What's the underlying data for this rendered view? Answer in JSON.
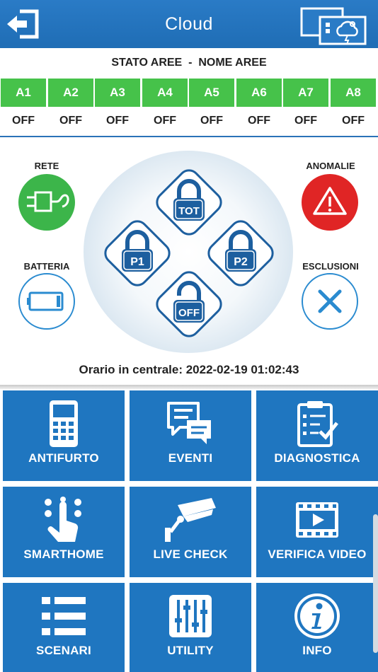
{
  "header": {
    "title": "Cloud"
  },
  "areas": {
    "title": "STATO AREE  -  NOME AREE",
    "items": [
      {
        "label": "A1",
        "state": "OFF"
      },
      {
        "label": "A2",
        "state": "OFF"
      },
      {
        "label": "A3",
        "state": "OFF"
      },
      {
        "label": "A4",
        "state": "OFF"
      },
      {
        "label": "A5",
        "state": "OFF"
      },
      {
        "label": "A6",
        "state": "OFF"
      },
      {
        "label": "A7",
        "state": "OFF"
      },
      {
        "label": "A8",
        "state": "OFF"
      }
    ]
  },
  "status": {
    "rete": "RETE",
    "batteria": "BATTERIA",
    "anomalie": "ANOMALIE",
    "esclusioni": "ESCLUSIONI"
  },
  "locks": {
    "tot": "TOT",
    "p1": "P1",
    "p2": "P2",
    "off": "OFF"
  },
  "clock": {
    "text": "Orario in centrale: 2022-02-19 01:02:43"
  },
  "menu": {
    "antifurto": "ANTIFURTO",
    "eventi": "EVENTI",
    "diagnostica": "DIAGNOSTICA",
    "smarthome": "SMARTHOME",
    "live_check": "LIVE CHECK",
    "verifica_video": "VERIFICA VIDEO",
    "scenari": "SCENARI",
    "utility": "UTILITY",
    "info": "INFO"
  },
  "colors": {
    "header_blue": "#2a7bc6",
    "tile_blue": "#1f76c0",
    "area_green": "#46c24a",
    "rete_green": "#3cb54a",
    "anomalie_red": "#e02525",
    "lock_blue": "#1d5f9f"
  },
  "icons": {
    "back": "exit-arrow-icon",
    "cloud": "cloud-devices-icon",
    "rete": "plug-icon",
    "anomalie": "warning-icon",
    "batteria": "battery-icon",
    "esclusioni": "cross-icon"
  }
}
